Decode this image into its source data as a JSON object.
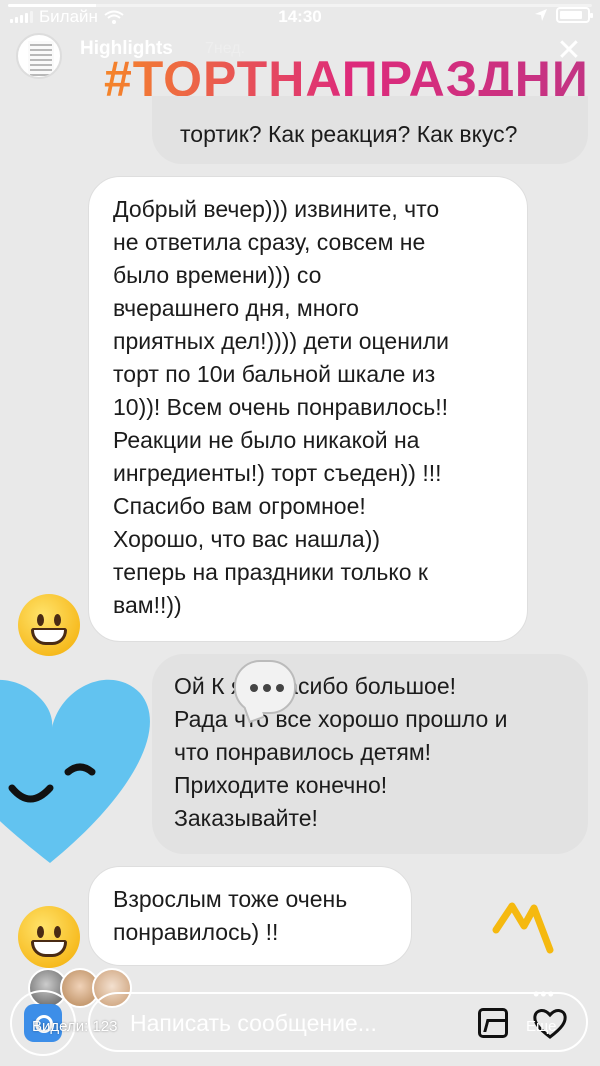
{
  "status_bar": {
    "carrier": "Билайн",
    "time": "14:30",
    "battery_level": 0.85
  },
  "story": {
    "progress": 0.15,
    "title": "Highlights",
    "age": "7нед.",
    "hashtag": "#ТОРТНАПРАЗДНИ"
  },
  "messages": [
    {
      "from": "me",
      "text": "тортик? Как реакция? Как вкус?"
    },
    {
      "from": "them",
      "lines": [
        "Добрый вечер))) извините, что",
        "не ответила сразу, совсем не",
        "было времени))) со",
        "вчерашнего дня, много",
        "приятных дел!)))) дети оценили",
        "торт по 10и бальной шкале из",
        "10))! Всем очень понравилось!!",
        "Реакции не было никакой на",
        "ингредиенты!) торт съеден)) !!!",
        "Спасибо вам огромное!",
        "Хорошо, что вас нашла))",
        "теперь на праздники только к",
        "вам!!))"
      ]
    },
    {
      "from": "me",
      "lines": [
        "Ой К      я! Спасибо большое!",
        "Рада  что все хорошо прошло и",
        "что понравилось детям!",
        "Приходите конечно!",
        "Заказывайте!"
      ]
    },
    {
      "from": "them",
      "lines": [
        "Взрослым тоже очень",
        "понравилось) !!"
      ]
    }
  ],
  "footer": {
    "views_label": "Видели: 123",
    "reply_placeholder": "Написать сообщение...",
    "more_label": "Еще",
    "more_dots": "•••"
  },
  "icons": {
    "close": "close-icon",
    "gallery": "gallery-icon",
    "like": "heart-outline-icon",
    "camera": "camera-icon"
  },
  "colors": {
    "hashtag_gradient": [
      "#f58529",
      "#dd2a7b",
      "#c13584"
    ],
    "heart_sticker": "#62c3f0",
    "crown_sticker": "#f5b90f"
  }
}
